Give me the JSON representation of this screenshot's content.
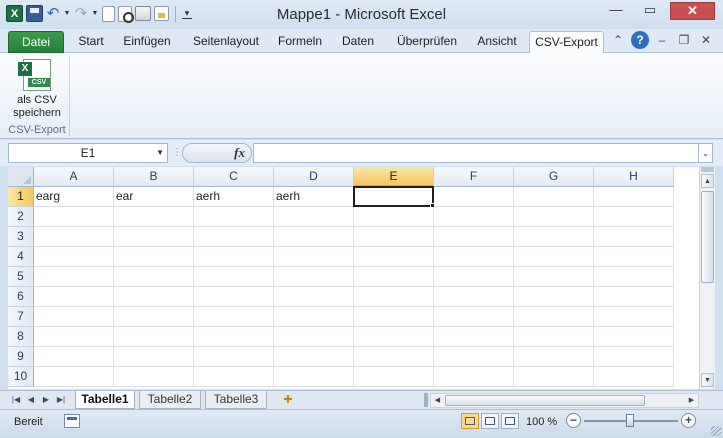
{
  "window": {
    "title": "Mappe1 - Microsoft Excel"
  },
  "ribbon": {
    "tabs": [
      "Datei",
      "Start",
      "Einfügen",
      "Seitenlayout",
      "Formeln",
      "Daten",
      "Überprüfen",
      "Ansicht",
      "CSV-Export"
    ],
    "active_tab": "CSV-Export",
    "group": {
      "button_label": "als CSV speichern",
      "group_label": "CSV-Export"
    }
  },
  "formula_bar": {
    "name_box": "E1",
    "fx_label": "fx",
    "formula": ""
  },
  "grid": {
    "columns": [
      "A",
      "B",
      "C",
      "D",
      "E",
      "F",
      "G",
      "H"
    ],
    "rows": [
      "1",
      "2",
      "3",
      "4",
      "5",
      "6",
      "7",
      "8",
      "9",
      "10"
    ],
    "selected_column": "E",
    "selected_row": "1",
    "cells": {
      "A1": "earg",
      "B1": "ear",
      "C1": "aerh",
      "D1": "aerh"
    }
  },
  "sheets": {
    "tabs": [
      "Tabelle1",
      "Tabelle2",
      "Tabelle3"
    ],
    "active": "Tabelle1"
  },
  "status": {
    "text": "Bereit",
    "zoom": "100 %"
  }
}
